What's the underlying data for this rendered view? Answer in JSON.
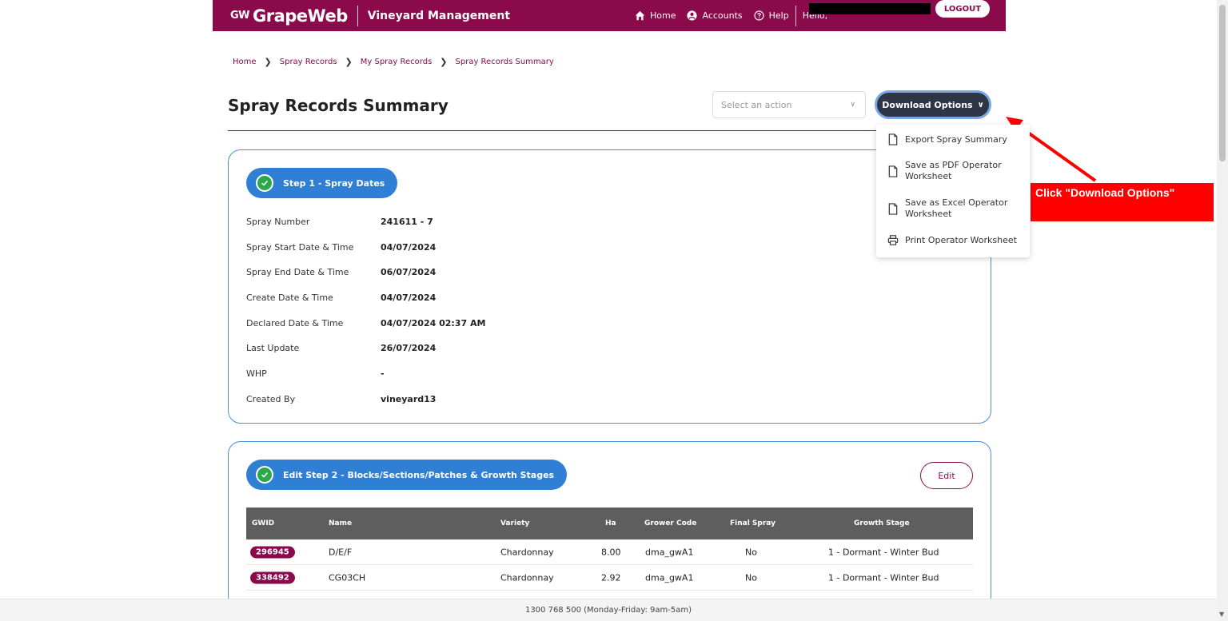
{
  "header": {
    "brand_prefix": "GW",
    "brand_name": "GrapeWeb",
    "brand_sub": "Vineyard Management",
    "nav": [
      {
        "label": "Home",
        "icon": "home-icon"
      },
      {
        "label": "Accounts",
        "icon": "account-icon"
      },
      {
        "label": "Help",
        "icon": "help-icon"
      }
    ],
    "hello": "Hello,",
    "logout": "LOGOUT",
    "color": "#8b0a4b"
  },
  "breadcrumb": [
    "Home",
    "Spray Records",
    "My Spray Records",
    "Spray Records Summary"
  ],
  "page": {
    "title": "Spray Records Summary",
    "select_placeholder": "Select an action",
    "download_label": "Download Options"
  },
  "dropdown": {
    "items": [
      {
        "label": "Export Spray Summary",
        "icon": "document-icon"
      },
      {
        "label1": "Save as PDF Operator",
        "label2": "Worksheet",
        "icon": "document-icon"
      },
      {
        "label1": "Save as Excel Operator",
        "label2": "Worksheet",
        "icon": "document-icon"
      },
      {
        "label": "Print Operator Worksheet",
        "icon": "printer-icon"
      }
    ]
  },
  "callout": "Click \"Download Options\"",
  "step1": {
    "label": "Step 1 - Spray Dates",
    "rows": [
      {
        "label": "Spray Number",
        "value": "241611 - 7"
      },
      {
        "label": "Spray Start Date & Time",
        "value": "04/07/2024"
      },
      {
        "label": "Spray End Date & Time",
        "value": "06/07/2024"
      },
      {
        "label": "Create Date & Time",
        "value": "04/07/2024"
      },
      {
        "label": "Declared Date & Time",
        "value": "04/07/2024 02:37 AM"
      },
      {
        "label": "Last Update",
        "value": "26/07/2024"
      },
      {
        "label": "WHP",
        "value": "-"
      },
      {
        "label": "Created By",
        "value": "vineyard13"
      }
    ]
  },
  "step2": {
    "label": "Edit Step 2 - Blocks/Sections/Patches & Growth Stages",
    "edit": "Edit",
    "columns": [
      "GWID",
      "Name",
      "Variety",
      "Ha",
      "Grower Code",
      "Final Spray",
      "Growth Stage"
    ],
    "rows": [
      {
        "gwid": "296945",
        "name": "D/E/F",
        "variety": "Chardonnay",
        "ha": "8.00",
        "grower": "dma_gwA1",
        "final": "No",
        "stage": "1 - Dormant - Winter Bud"
      },
      {
        "gwid": "338492",
        "name": "CG03CH",
        "variety": "Chardonnay",
        "ha": "2.92",
        "grower": "dma_gwA1",
        "final": "No",
        "stage": "1 - Dormant - Winter Bud"
      }
    ]
  },
  "footer": "1300 768 500 (Monday-Friday: 9am-5am)"
}
